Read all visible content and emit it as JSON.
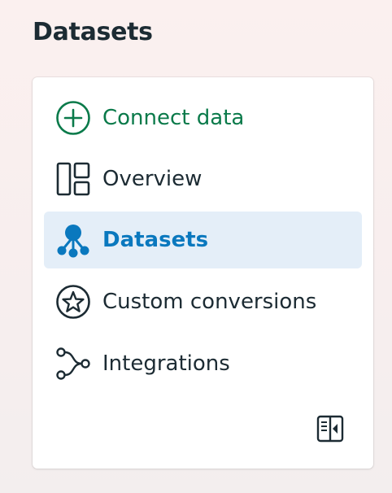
{
  "page": {
    "title": "Datasets"
  },
  "nav": {
    "items": [
      {
        "id": "connect-data",
        "label": "Connect data",
        "icon": "plus-circle-icon",
        "color": "#0a7a4a"
      },
      {
        "id": "overview",
        "label": "Overview",
        "icon": "layout-panels-icon",
        "color": "#1c2b33"
      },
      {
        "id": "datasets",
        "label": "Datasets",
        "icon": "network-nodes-icon",
        "color": "#0a78be",
        "active": true
      },
      {
        "id": "custom-conversions",
        "label": "Custom conversions",
        "icon": "star-circle-icon",
        "color": "#1c2b33"
      },
      {
        "id": "integrations",
        "label": "Integrations",
        "icon": "branch-connector-icon",
        "color": "#1c2b33"
      }
    ],
    "collapse_icon": "collapse-panel-icon"
  },
  "colors": {
    "accent_green": "#0a7a4a",
    "accent_blue": "#0a78be",
    "active_bg": "#e4eef8",
    "text": "#1c2b33"
  }
}
